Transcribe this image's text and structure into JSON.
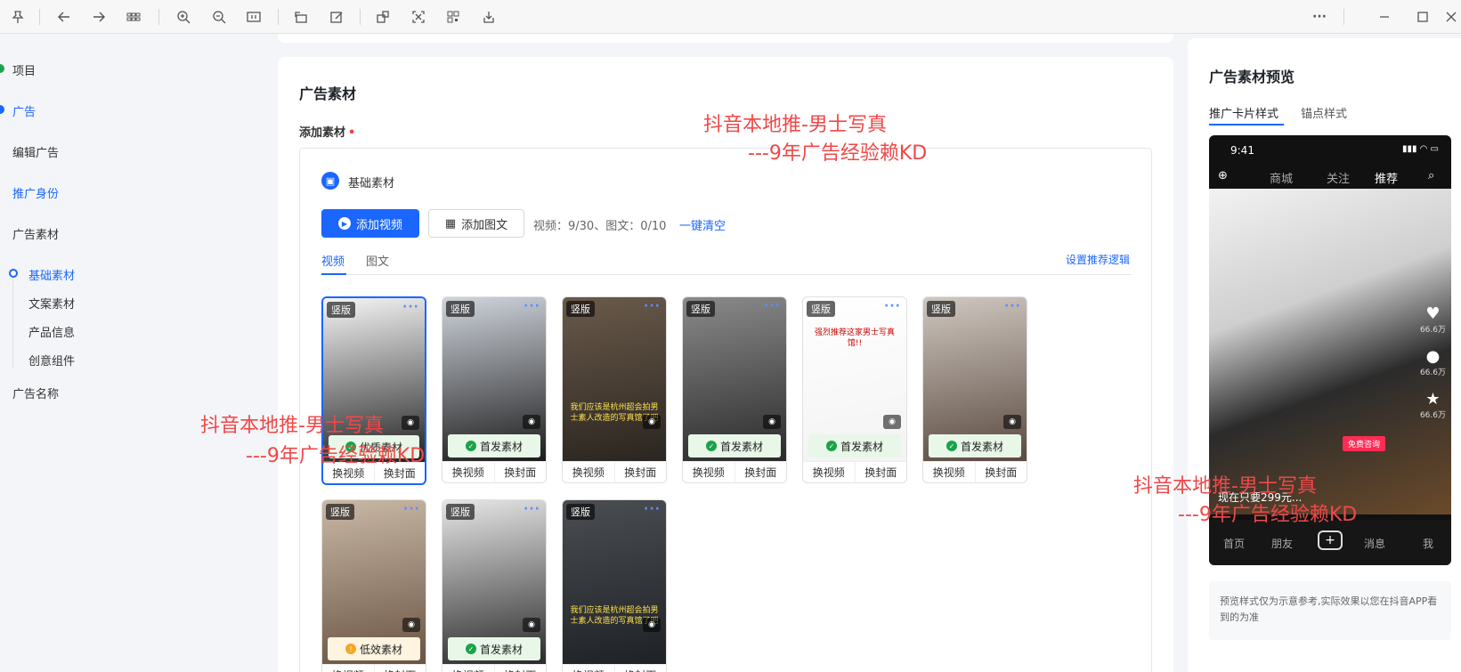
{
  "toolbar": {
    "icons": [
      "pin-icon",
      "back-icon",
      "forward-icon",
      "grid-icon",
      "zoom-in-icon",
      "zoom-out-icon",
      "fit-width-icon",
      "rotate-icon",
      "edit-icon",
      "crop-icon",
      "screenshot-icon",
      "qr-icon",
      "download-icon",
      "more-icon",
      "minimize-icon",
      "maximize-icon",
      "close-icon"
    ],
    "more_label": "···"
  },
  "sidebar": {
    "items": [
      {
        "label": "项目"
      },
      {
        "label": "广告"
      },
      {
        "label": "编辑广告"
      },
      {
        "label": "推广身份"
      },
      {
        "label": "广告素材"
      },
      {
        "label": "广告名称"
      }
    ],
    "sub_items": [
      {
        "label": "基础素材"
      },
      {
        "label": "文案素材"
      },
      {
        "label": "产品信息"
      },
      {
        "label": "创意组件"
      }
    ]
  },
  "main": {
    "section_title": "广告素材",
    "field_label": "添加素材",
    "required_mark": "•",
    "base_label": "基础素材",
    "add_video": "添加视频",
    "add_image": "添加图文",
    "count_text": "视频：9/30、图文：0/10",
    "clear_all": "一键清空",
    "tabs": [
      {
        "label": "视频"
      },
      {
        "label": "图文"
      }
    ],
    "recommend_link": "设置推荐逻辑",
    "thumb_badge": "竖版",
    "thumb_more": "···",
    "action_replace_video": "换视频",
    "action_replace_cover": "换封面",
    "thumbs": [
      {
        "status": "优质素材",
        "status_type": "ok",
        "colors": [
          "#f5f5f5",
          "#222"
        ]
      },
      {
        "status": "首发素材",
        "status_type": "ok",
        "colors": [
          "#cfd4dc",
          "#1b1b1b"
        ]
      },
      {
        "status": "",
        "status_type": "none",
        "colors": [
          "#6a5a4a",
          "#2a2520"
        ],
        "caption": "我们应该是杭州超会拍男士素人改造的写真馆了吧"
      },
      {
        "status": "首发素材",
        "status_type": "ok",
        "colors": [
          "#8a8a8a",
          "#2a2a2a"
        ]
      },
      {
        "status": "首发素材",
        "status_type": "ok",
        "colors": [
          "#ffffff",
          "#f3f3f3"
        ],
        "caption": "强烈推荐这家男士写真馆!!"
      },
      {
        "status": "首发素材",
        "status_type": "ok",
        "colors": [
          "#cfc7c0",
          "#5a4a40"
        ]
      },
      {
        "status": "低效素材",
        "status_type": "low",
        "colors": [
          "#c9b8a6",
          "#6a5444"
        ]
      },
      {
        "status": "首发素材",
        "status_type": "ok",
        "colors": [
          "#e6e6e6",
          "#2a2a2a"
        ]
      },
      {
        "status": "",
        "status_type": "none",
        "colors": [
          "#4a4e52",
          "#1e2226"
        ],
        "caption": "我们应该是杭州超会拍男士素人改造的写真馆了吧"
      }
    ]
  },
  "preview": {
    "title": "广告素材预览",
    "tabs": [
      {
        "label": "推广卡片样式"
      },
      {
        "label": "锚点样式"
      }
    ],
    "phone": {
      "time": "9:41",
      "nav": [
        "商城",
        "关注",
        "推荐"
      ],
      "side_counts": [
        "66.6万",
        "66.6万",
        "66.6万"
      ],
      "cta": "免费咨询",
      "desc": "现在只要299元...",
      "bottom_nav": [
        "首页",
        "朋友",
        "消息",
        "我"
      ]
    },
    "note": "预览样式仅为示意参考,实际效果以您在抖音APP看到的为准"
  },
  "watermarks": [
    {
      "line1": "抖音本地推-男士写真",
      "line2": "---9年广告经验赖KD"
    },
    {
      "line1": "抖音本地推-男士写真",
      "line2": "---9年广告经验赖KD"
    },
    {
      "line1": "抖音本地推-男士写真",
      "line2": "---9年广告经验赖KD"
    }
  ]
}
